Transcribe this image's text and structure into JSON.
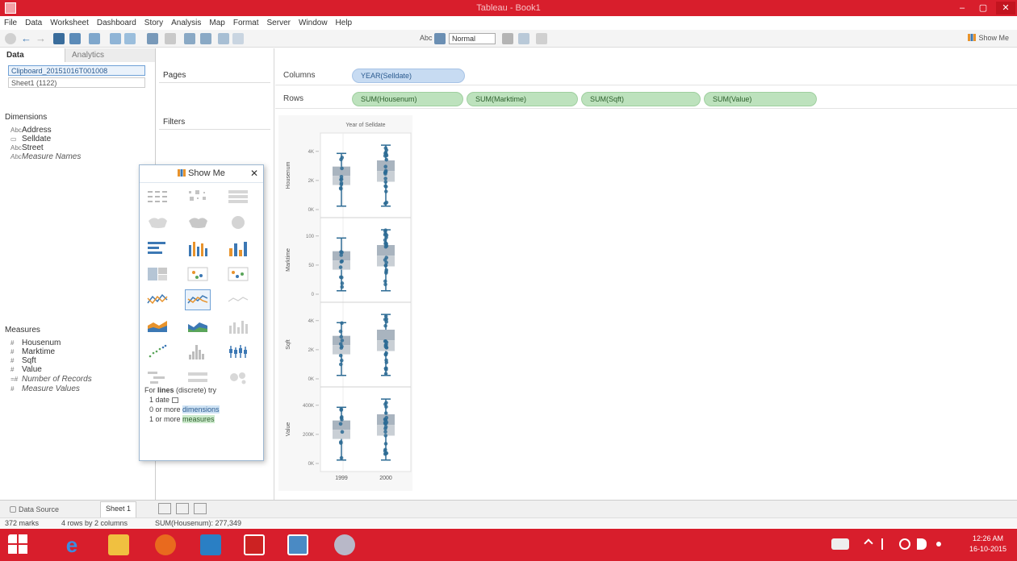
{
  "window": {
    "title": "Tableau - Book1",
    "minimize": "–",
    "maximize": "▢",
    "close": "✕"
  },
  "menu": [
    "File",
    "Data",
    "Worksheet",
    "Dashboard",
    "Story",
    "Analysis",
    "Map",
    "Format",
    "Server",
    "Window",
    "Help"
  ],
  "toolbar": {
    "text_tool": "Abc",
    "fit_value": "Normal",
    "show_me": "Show Me"
  },
  "left": {
    "tab_data": "Data",
    "tab_analytics": "Analytics",
    "datasource": "Clipboard_20151016T001008",
    "sheet_source": "Sheet1 (1122)",
    "dimensions_label": "Dimensions",
    "dimensions": [
      {
        "type": "Abc",
        "name": "Address",
        "italic": false
      },
      {
        "type": "▭",
        "name": "Selldate",
        "italic": false
      },
      {
        "type": "Abc",
        "name": "Street",
        "italic": false
      },
      {
        "type": "Abc",
        "name": "Measure Names",
        "italic": true
      }
    ],
    "measures_label": "Measures",
    "measures": [
      {
        "type": "#",
        "name": "Housenum",
        "italic": false
      },
      {
        "type": "#",
        "name": "Marktime",
        "italic": false
      },
      {
        "type": "#",
        "name": "Sqft",
        "italic": false
      },
      {
        "type": "#",
        "name": "Value",
        "italic": false
      },
      {
        "type": "=#",
        "name": "Number of Records",
        "italic": true
      },
      {
        "type": "#",
        "name": "Measure Values",
        "italic": true
      }
    ]
  },
  "cards": {
    "pages": "Pages",
    "filters": "Filters"
  },
  "shelves": {
    "columns_label": "Columns",
    "columns_pills": [
      "YEAR(Selldate)"
    ],
    "rows_label": "Rows",
    "rows_pills": [
      "SUM(Housenum)",
      "SUM(Marktime)",
      "SUM(Sqft)",
      "SUM(Value)"
    ]
  },
  "showme": {
    "title": "Show Me",
    "close": "✕",
    "hint_prefix": "For ",
    "hint_bold": "lines",
    "hint_suffix": " (discrete) try",
    "req_date": "1 date",
    "req_dims_prefix": "0 or more ",
    "req_dims_hl": "dimensions",
    "req_meas_prefix": "1 or more ",
    "req_meas_hl": "measures"
  },
  "chart_data": {
    "type": "scatter",
    "title": "Year of Selldate",
    "categories": [
      "1999",
      "2000"
    ],
    "panes": [
      {
        "name": "Housenum",
        "ticks": [
          "0K",
          "2K",
          "4K"
        ],
        "ylim": [
          0,
          4800
        ]
      },
      {
        "name": "Marktime",
        "ticks": [
          "0",
          "50",
          "100"
        ],
        "ylim": [
          0,
          120
        ]
      },
      {
        "name": "Sqft",
        "ticks": [
          "0K",
          "2K",
          "4K"
        ],
        "ylim": [
          0,
          4800
        ]
      },
      {
        "name": "Value",
        "ticks": [
          "0K",
          "200K",
          "400K"
        ],
        "ylim": [
          0,
          480000
        ]
      }
    ]
  },
  "bottom": {
    "data_source": "Data Source",
    "sheet1": "Sheet 1"
  },
  "status": {
    "marks": "372 marks",
    "dims": "4 rows by 2 columns",
    "sum": "SUM(Housenum): 277,349"
  },
  "clock": {
    "time": "12:26 AM",
    "date": "16-10-2015"
  },
  "colors": {
    "accent": "#d81e2c",
    "mark": "#2d6b94",
    "pill_green": "#bde2bd",
    "pill_blue": "#c7dbf2"
  }
}
